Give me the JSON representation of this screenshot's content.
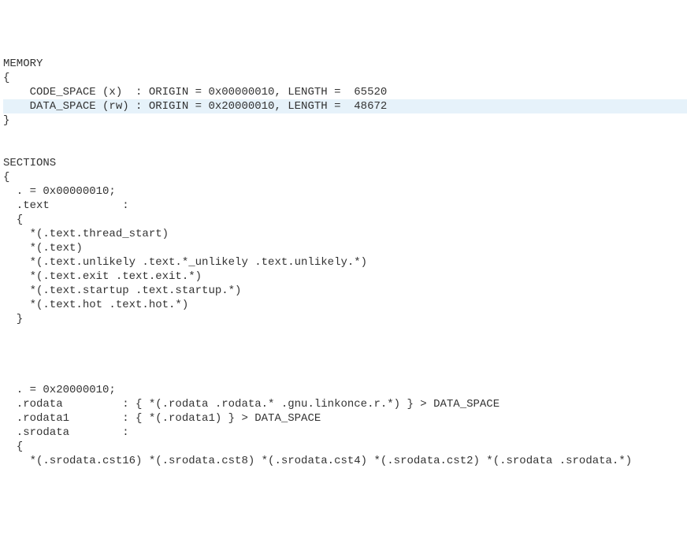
{
  "lines": [
    {
      "text": "MEMORY",
      "hl": false
    },
    {
      "text": "{",
      "hl": false
    },
    {
      "text": "    CODE_SPACE (x)  : ORIGIN = 0x00000010, LENGTH =  65520",
      "hl": false
    },
    {
      "text": "    DATA_SPACE (rw) : ORIGIN = 0x20000010, LENGTH =  48672",
      "hl": true
    },
    {
      "text": "}",
      "hl": false
    },
    {
      "text": "",
      "hl": false
    },
    {
      "text": "",
      "hl": false
    },
    {
      "text": "SECTIONS",
      "hl": false
    },
    {
      "text": "{",
      "hl": false
    },
    {
      "text": "  . = 0x00000010;",
      "hl": false
    },
    {
      "text": "  .text           :",
      "hl": false
    },
    {
      "text": "  {",
      "hl": false
    },
    {
      "text": "    *(.text.thread_start)",
      "hl": false
    },
    {
      "text": "    *(.text)",
      "hl": false
    },
    {
      "text": "    *(.text.unlikely .text.*_unlikely .text.unlikely.*)",
      "hl": false
    },
    {
      "text": "    *(.text.exit .text.exit.*)",
      "hl": false
    },
    {
      "text": "    *(.text.startup .text.startup.*)",
      "hl": false
    },
    {
      "text": "    *(.text.hot .text.hot.*)",
      "hl": false
    },
    {
      "text": "  }",
      "hl": false
    },
    {
      "text": "",
      "hl": false
    },
    {
      "text": "",
      "hl": false
    },
    {
      "text": "",
      "hl": false
    },
    {
      "text": "",
      "hl": false
    },
    {
      "text": "  . = 0x20000010;",
      "hl": false
    },
    {
      "text": "  .rodata         : { *(.rodata .rodata.* .gnu.linkonce.r.*) } > DATA_SPACE",
      "hl": false
    },
    {
      "text": "  .rodata1        : { *(.rodata1) } > DATA_SPACE",
      "hl": false
    },
    {
      "text": "  .srodata        :",
      "hl": false
    },
    {
      "text": "  {",
      "hl": false
    },
    {
      "text": "    *(.srodata.cst16) *(.srodata.cst8) *(.srodata.cst4) *(.srodata.cst2) *(.srodata .srodata.*)",
      "hl": false
    }
  ],
  "memory": {
    "CODE_SPACE": {
      "attrs": "x",
      "origin": "0x00000010",
      "length": 65520
    },
    "DATA_SPACE": {
      "attrs": "rw",
      "origin": "0x20000010",
      "length": 48672
    }
  }
}
